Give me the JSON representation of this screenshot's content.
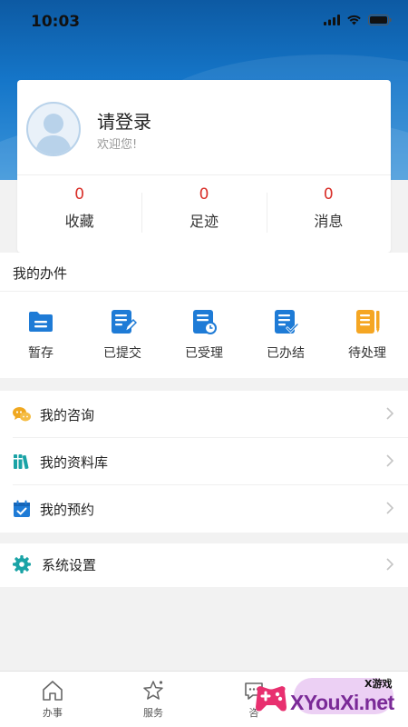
{
  "status_bar": {
    "time": "10:03"
  },
  "profile": {
    "title": "请登录",
    "subtitle": "欢迎您!"
  },
  "stats": [
    {
      "value": "0",
      "label": "收藏"
    },
    {
      "value": "0",
      "label": "足迹"
    },
    {
      "value": "0",
      "label": "消息"
    }
  ],
  "work": {
    "title": "我的办件",
    "items": [
      {
        "label": "暂存",
        "icon": "folder-icon",
        "color": "#1e7bd6"
      },
      {
        "label": "已提交",
        "icon": "document-edit-icon",
        "color": "#1e7bd6"
      },
      {
        "label": "已受理",
        "icon": "document-clock-icon",
        "color": "#1e7bd6"
      },
      {
        "label": "已办结",
        "icon": "document-check-icon",
        "color": "#1e7bd6"
      },
      {
        "label": "待处理",
        "icon": "document-pending-icon",
        "color": "#f5a623"
      }
    ]
  },
  "menu": [
    {
      "label": "我的咨询",
      "icon": "chat-bubbles-icon",
      "color": "#f0a820"
    },
    {
      "label": "我的资料库",
      "icon": "library-icon",
      "color": "#1aa3a6"
    },
    {
      "label": "我的预约",
      "icon": "calendar-check-icon",
      "color": "#1e7bd6"
    }
  ],
  "settings": {
    "label": "系统设置",
    "icon": "gear-icon",
    "color": "#1aa3a6"
  },
  "tabbar": [
    {
      "label": "办事",
      "icon": "home-icon"
    },
    {
      "label": "服务",
      "icon": "star-icon"
    },
    {
      "label": "咨",
      "icon": "chat-icon"
    }
  ],
  "watermark": {
    "text": "XYouXi.net",
    "small": "X游戏"
  }
}
